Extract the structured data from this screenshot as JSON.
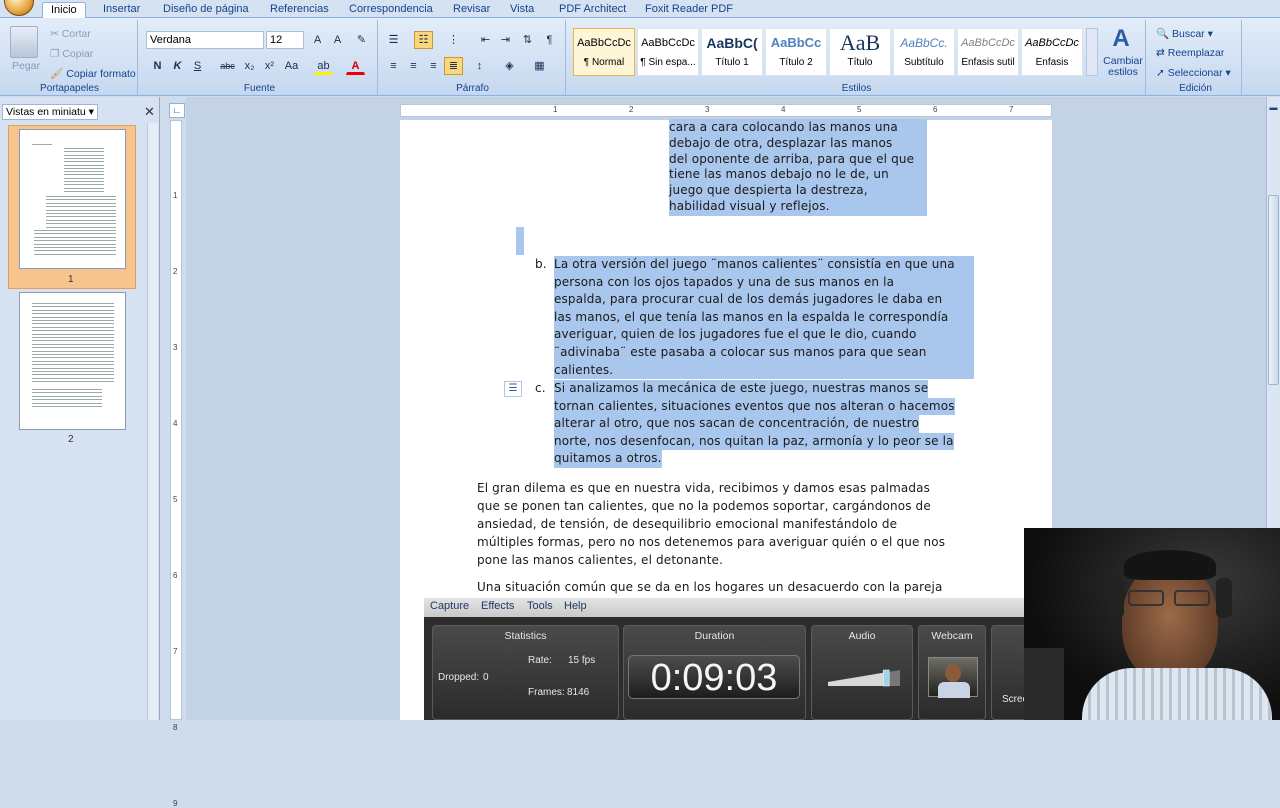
{
  "ribbon_tabs": [
    "Inicio",
    "Insertar",
    "Diseño de página",
    "Referencias",
    "Correspondencia",
    "Revisar",
    "Vista",
    "PDF Architect",
    "Foxit Reader PDF"
  ],
  "clipboard": {
    "paste": "Pegar",
    "cut": "Cortar",
    "copy": "Copiar",
    "format_painter": "Copiar formato",
    "label": "Portapapeles"
  },
  "font": {
    "family": "Verdana",
    "size": "12",
    "label": "Fuente"
  },
  "paragraph": {
    "label": "Párrafo"
  },
  "styles": {
    "label": "Estilos",
    "items": [
      {
        "preview": "AaBbCcDc",
        "name": "¶ Normal"
      },
      {
        "preview": "AaBbCcDc",
        "name": "¶ Sin espa..."
      },
      {
        "preview": "AaBbC(",
        "name": "Título 1"
      },
      {
        "preview": "AaBbCc",
        "name": "Título 2"
      },
      {
        "preview": "AaB",
        "name": "Título"
      },
      {
        "preview": "AaBbCc.",
        "name": "Subtítulo"
      },
      {
        "preview": "AaBbCcDc",
        "name": "Énfasis sutil"
      },
      {
        "preview": "AaBbCcDc",
        "name": "Énfasis"
      }
    ],
    "change_styles": "Cambiar estilos"
  },
  "editing": {
    "find": "Buscar",
    "replace": "Reemplazar",
    "select": "Seleccionar",
    "label": "Edición"
  },
  "left_pane": {
    "title": "Vistas en miniatu",
    "pages": [
      "1",
      "2"
    ]
  },
  "ruler_numbers": [
    "1",
    "2",
    "3",
    "4",
    "5",
    "6",
    "7"
  ],
  "vruler_numbers": [
    "1",
    "2",
    "3",
    "4",
    "5",
    "6",
    "7",
    "8",
    "9"
  ],
  "document": {
    "top_block": [
      "cara a cara colocando las manos  una",
      "debajo de otra,   desplazar las manos",
      "del oponente de arriba, para que el que",
      "tiene las manos debajo no le de,  un",
      "juego  que  despierta  la  destreza,",
      "habilidad visual y reflejos."
    ],
    "item_b_marker": "b.",
    "item_b": [
      "La otra versión del juego ¨manos calientes¨ consistía en que una",
      "persona   con los ojos tapados y una   de sus manos en la",
      "espalda,  para procurar cual de los demás jugadores le daba en",
      "las manos, el que tenía las manos en la espalda le correspondía",
      "averiguar, quien de los jugadores fue el que le dio, cuando",
      "¨adivinaba¨ este pasaba a  colocar sus manos para que sean",
      "calientes."
    ],
    "item_c_marker": "c.",
    "item_c": [
      "Si analizamos la mecánica de este  juego, nuestras manos se",
      "tornan calientes, situaciones eventos que nos alteran o hacemos",
      "alterar al otro, que nos sacan de concentración, de nuestro",
      "norte, nos desenfocan, nos quitan la paz, armonía y lo peor se la",
      "quitamos a otros."
    ],
    "para1": [
      "El gran dilema es que en nuestra vida, recibimos y damos esas palmadas",
      "que se ponen tan calientes,  que no la podemos soportar, cargándonos de",
      "ansiedad, de tensión, de desequilibrio emocional manifestándolo de",
      "múltiples formas, pero no nos detenemos para averiguar quién o el que nos",
      "pone las manos calientes,  el detonante."
    ],
    "para2": [
      "Una situación común que se da en los hogares un desacuerdo  con la pareja"
    ]
  },
  "capture": {
    "menu": [
      "Capture",
      "Effects",
      "Tools",
      "Help"
    ],
    "statistics": {
      "title": "Statistics",
      "rate_label": "Rate:",
      "rate": "15 fps",
      "dropped_label": "Dropped:",
      "dropped": "0",
      "frames_label": "Frames:",
      "frames": "8146"
    },
    "duration": {
      "title": "Duration",
      "value": "0:09:03"
    },
    "audio": {
      "title": "Audio",
      "level": 0.85
    },
    "webcam": {
      "title": "Webcam"
    },
    "screen_label": "Scree"
  }
}
